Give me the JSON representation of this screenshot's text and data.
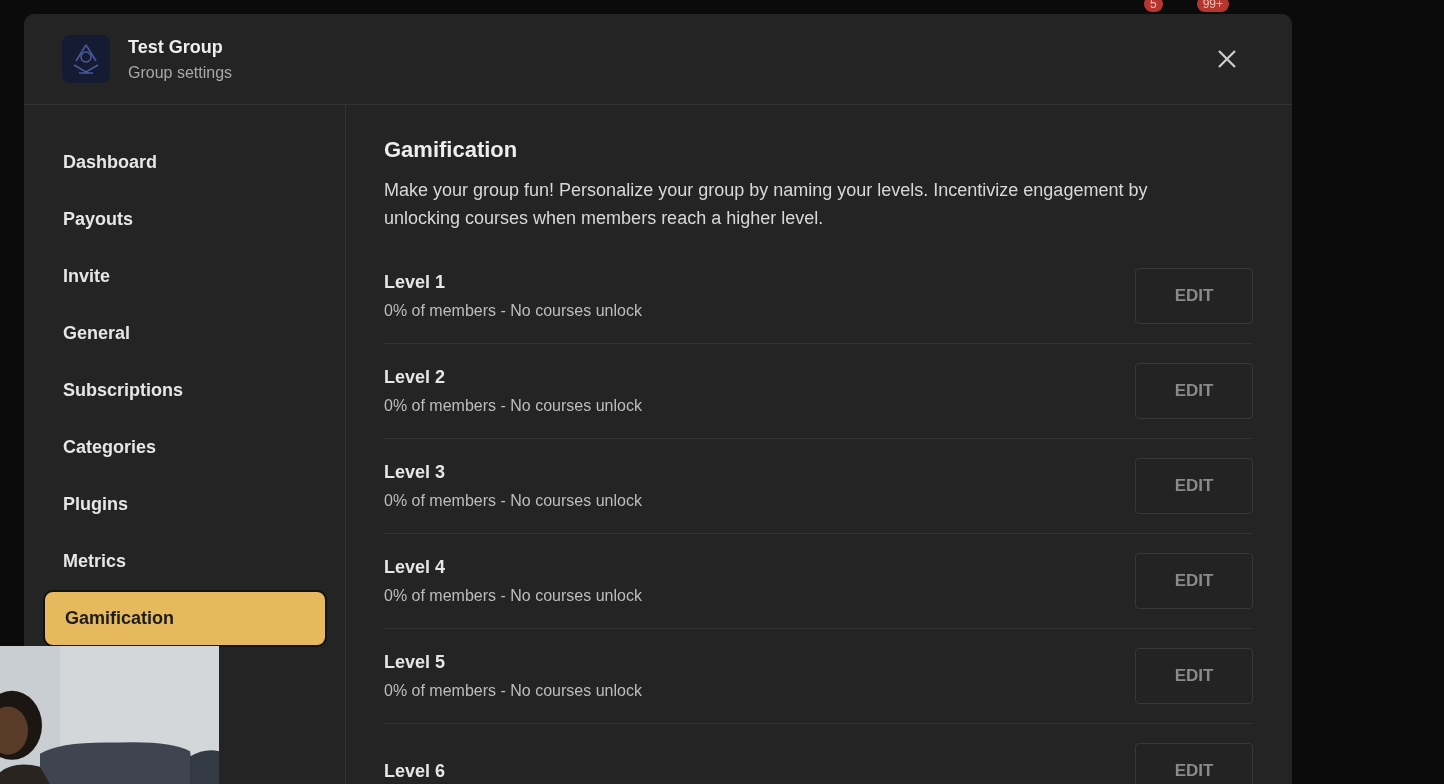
{
  "background": {
    "badges": [
      {
        "count": "5"
      },
      {
        "count": "99+"
      }
    ]
  },
  "modal": {
    "group_name": "Test Group",
    "subtitle": "Group settings"
  },
  "sidebar": {
    "items": [
      {
        "label": "Dashboard",
        "selected": false
      },
      {
        "label": "Payouts",
        "selected": false
      },
      {
        "label": "Invite",
        "selected": false
      },
      {
        "label": "General",
        "selected": false
      },
      {
        "label": "Subscriptions",
        "selected": false
      },
      {
        "label": "Categories",
        "selected": false
      },
      {
        "label": "Plugins",
        "selected": false
      },
      {
        "label": "Metrics",
        "selected": false
      },
      {
        "label": "Gamification",
        "selected": true
      }
    ]
  },
  "content": {
    "title": "Gamification",
    "description": "Make your group fun! Personalize your group by naming your levels. Incentivize engagement by unlocking courses when members reach a higher level.",
    "levels": [
      {
        "name": "Level 1",
        "detail": "0% of members - No courses unlock",
        "button": "EDIT"
      },
      {
        "name": "Level 2",
        "detail": "0% of members - No courses unlock",
        "button": "EDIT"
      },
      {
        "name": "Level 3",
        "detail": "0% of members - No courses unlock",
        "button": "EDIT"
      },
      {
        "name": "Level 4",
        "detail": "0% of members - No courses unlock",
        "button": "EDIT"
      },
      {
        "name": "Level 5",
        "detail": "0% of members - No courses unlock",
        "button": "EDIT"
      },
      {
        "name": "Level 6",
        "button": "EDIT"
      }
    ]
  }
}
